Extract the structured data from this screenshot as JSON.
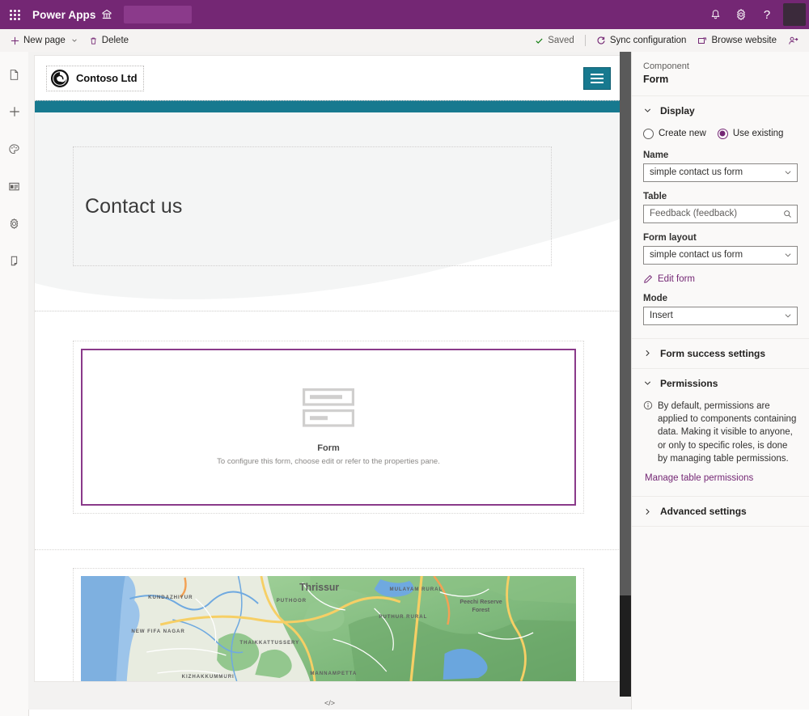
{
  "topbar": {
    "waffle_label": "app-launcher",
    "brand": "Power Apps",
    "icons": {
      "environment": "environment-icon",
      "notifications": "bell-icon",
      "settings": "gear-icon",
      "help": "?",
      "avatar": "user-avatar"
    }
  },
  "commandbar": {
    "new_page": "New page",
    "delete": "Delete",
    "saved": "Saved",
    "sync": "Sync configuration",
    "browse": "Browse website",
    "share": "share-icon"
  },
  "rail": {
    "items": [
      {
        "name": "pages-icon",
        "label": "Pages"
      },
      {
        "name": "add-icon",
        "label": "Add"
      },
      {
        "name": "theme-palette-icon",
        "label": "Theme"
      },
      {
        "name": "templates-icon",
        "label": "Templates"
      },
      {
        "name": "settings-gear-icon",
        "label": "Settings"
      },
      {
        "name": "device-preview-icon",
        "label": "Preview device"
      }
    ]
  },
  "canvas": {
    "site_header": {
      "logo_text": "Contoso Ltd",
      "menu_icon": "hamburger-menu-icon"
    },
    "hero": {
      "title": "Contact us"
    },
    "form_placeholder": {
      "icon": "form-icon",
      "title": "Form",
      "description": "To configure this form, choose edit or refer to the properties pane."
    },
    "map": {
      "labels": [
        "Thrissur",
        "KUNDAZHIYUR",
        "NEW FIFA NAGAR",
        "THAIKKATTUSSERY",
        "KIZHAKKUMMURI",
        "MULAYAM RURAL",
        "PUTHOOR",
        "PUTHUR RURAL",
        "MANNAMPETTA",
        "Peechi Reserve Forest"
      ]
    }
  },
  "panel": {
    "kicker": "Component",
    "title": "Form",
    "display": {
      "section_title": "Display",
      "radios": [
        {
          "label": "Create new",
          "selected": false
        },
        {
          "label": "Use existing",
          "selected": true
        }
      ],
      "name_label": "Name",
      "name_value": "simple contact us form",
      "table_label": "Table",
      "table_value": "Feedback (feedback)",
      "layout_label": "Form layout",
      "layout_value": "simple contact us form",
      "edit_form_link": "Edit form",
      "mode_label": "Mode",
      "mode_value": "Insert"
    },
    "form_success": {
      "section_title": "Form success settings"
    },
    "permissions": {
      "section_title": "Permissions",
      "note": "By default, permissions are applied to components containing data. Making it visible to anyone, or only to specific roles, is done by managing table permissions.",
      "link": "Manage table permissions"
    },
    "advanced": {
      "section_title": "Advanced settings"
    }
  },
  "statusbar": {
    "code_icon": "</>"
  },
  "colors": {
    "brand_purple": "#742774",
    "accent_teal": "#17798f",
    "selection_purple": "#8a3a8a",
    "link_purple": "#742774"
  }
}
